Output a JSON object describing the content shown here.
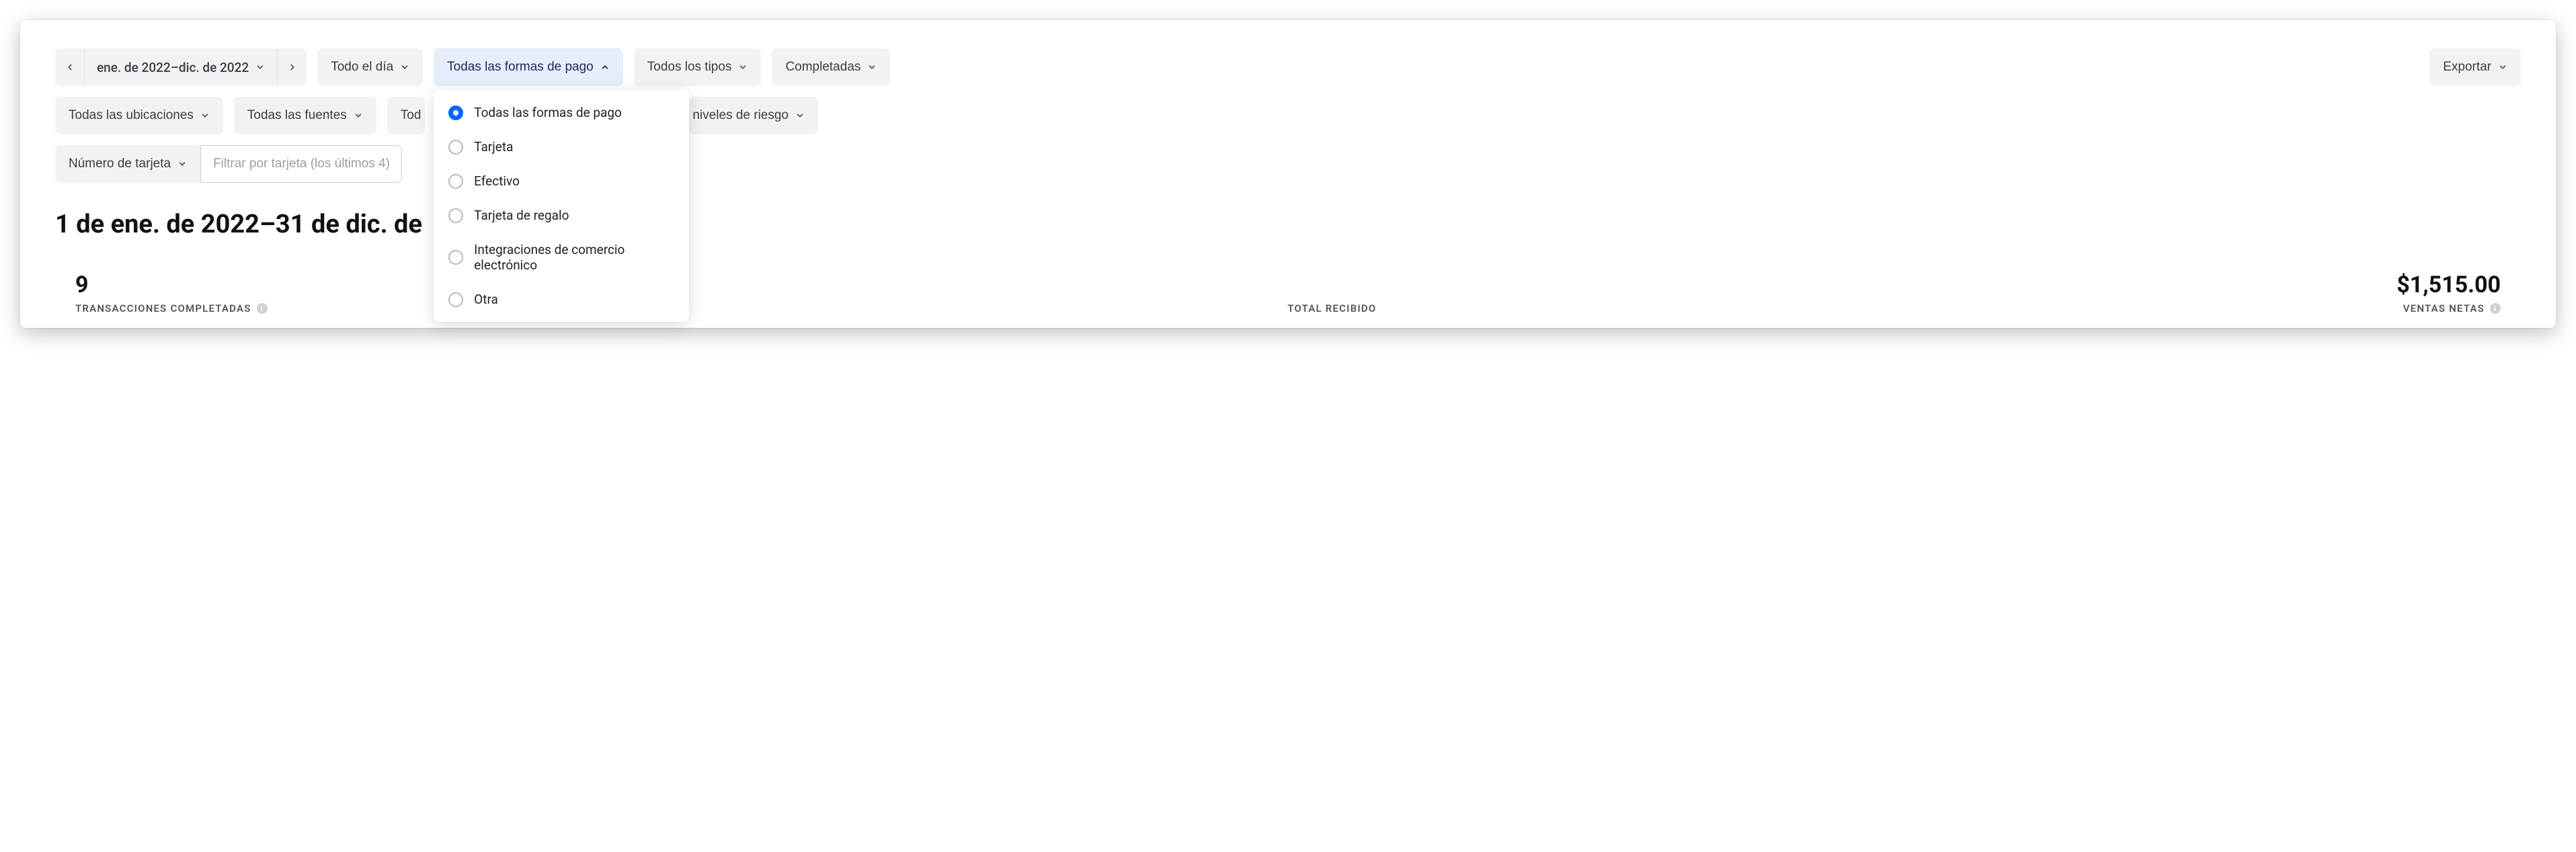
{
  "filters": {
    "date_range": "ene. de 2022–dic. de 2022",
    "time": "Todo el día",
    "payment_methods": {
      "label": "Todas las formas de pago",
      "options": [
        "Todas las formas de pago",
        "Tarjeta",
        "Efectivo",
        "Tarjeta de regalo",
        "Integraciones de comercio electrónico",
        "Otra"
      ],
      "selected_index": 0
    },
    "types": "Todos los tipos",
    "status": "Completadas",
    "export": "Exportar",
    "locations": "Todas las ubicaciones",
    "sources": "Todas las fuentes",
    "all_prefix": "Tod",
    "risk_levels": "niveles de riesgo",
    "card_number_label": "Número de tarjeta",
    "card_number_placeholder": "Filtrar por tarjeta (los últimos 4)"
  },
  "heading": "1 de ene. de 2022–31 de dic. de",
  "stats": {
    "completed": {
      "value": "9",
      "label": "TRANSACCIONES COMPLETADAS"
    },
    "received": {
      "label": "TOTAL RECIBIDO"
    },
    "net": {
      "value": "$1,515.00",
      "label": "VENTAS NETAS"
    }
  }
}
